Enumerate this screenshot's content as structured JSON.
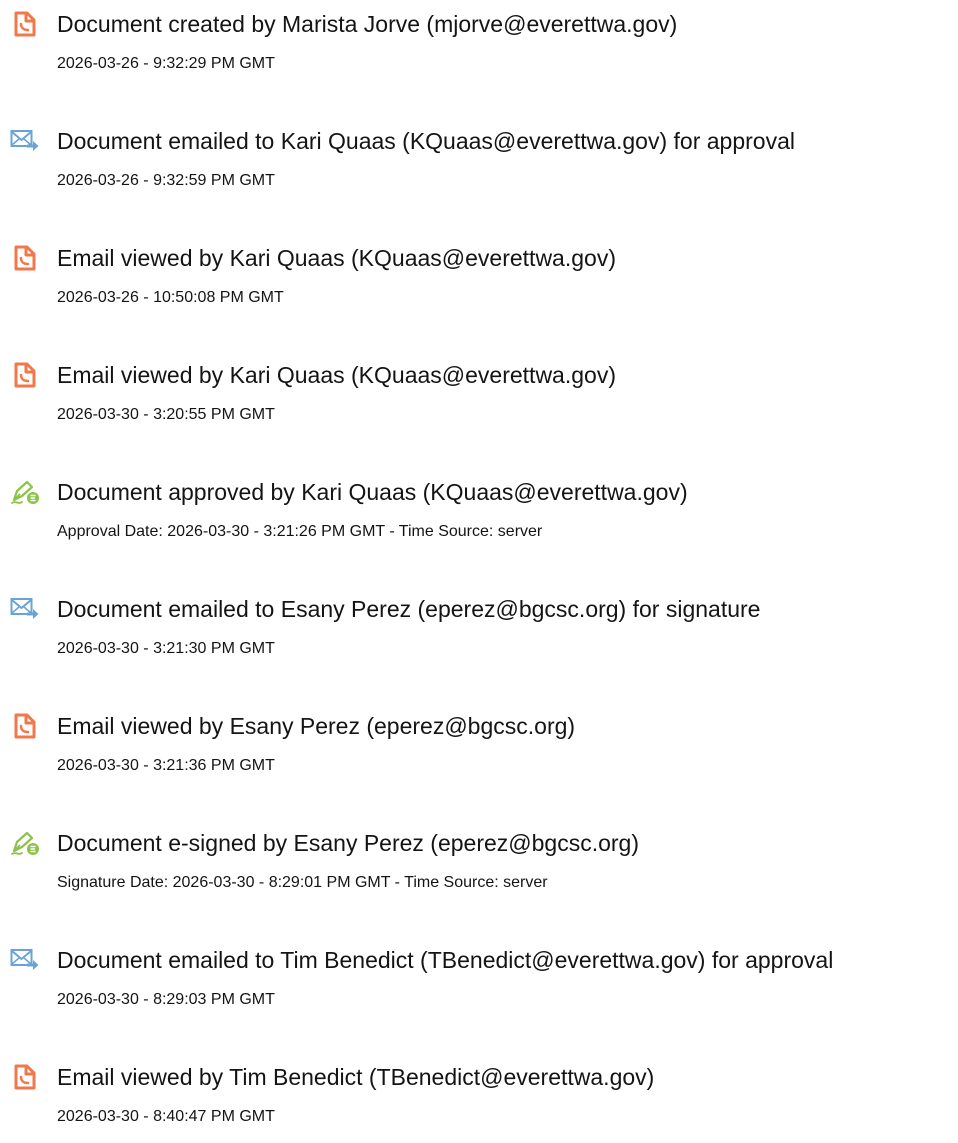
{
  "events": [
    {
      "icon": "document-icon",
      "title": "Document created by Marista Jorve (mjorve@everettwa.gov)",
      "subtitle": "2026-03-26 - 9:32:29 PM GMT"
    },
    {
      "icon": "email-sent-icon",
      "title": "Document emailed to Kari Quaas (KQuaas@everettwa.gov) for approval",
      "subtitle": "2026-03-26 - 9:32:59 PM GMT"
    },
    {
      "icon": "document-icon",
      "title": "Email viewed by Kari Quaas (KQuaas@everettwa.gov)",
      "subtitle": "2026-03-26 - 10:50:08 PM GMT"
    },
    {
      "icon": "document-icon",
      "title": "Email viewed by Kari Quaas (KQuaas@everettwa.gov)",
      "subtitle": "2026-03-30 - 3:20:55 PM GMT"
    },
    {
      "icon": "pen-sign-icon",
      "title": "Document approved by Kari Quaas (KQuaas@everettwa.gov)",
      "subtitle": "Approval Date: 2026-03-30 - 3:21:26 PM GMT - Time Source: server"
    },
    {
      "icon": "email-sent-icon",
      "title": "Document emailed to Esany Perez (eperez@bgcsc.org) for signature",
      "subtitle": "2026-03-30 - 3:21:30 PM GMT"
    },
    {
      "icon": "document-icon",
      "title": "Email viewed by Esany Perez (eperez@bgcsc.org)",
      "subtitle": "2026-03-30 - 3:21:36 PM GMT"
    },
    {
      "icon": "pen-sign-icon",
      "title": "Document e-signed by Esany Perez (eperez@bgcsc.org)",
      "subtitle": "Signature Date: 2026-03-30 - 8:29:01 PM GMT - Time Source: server"
    },
    {
      "icon": "email-sent-icon",
      "title": "Document emailed to Tim Benedict (TBenedict@everettwa.gov) for approval",
      "subtitle": "2026-03-30 - 8:29:03 PM GMT"
    },
    {
      "icon": "document-icon",
      "title": "Email viewed by Tim Benedict (TBenedict@everettwa.gov)",
      "subtitle": "2026-03-30 - 8:40:47 PM GMT"
    }
  ],
  "colors": {
    "document_icon": "#f0784a",
    "email_icon": "#6aa4d6",
    "pen_icon": "#8bc34a",
    "text": "#141414"
  }
}
